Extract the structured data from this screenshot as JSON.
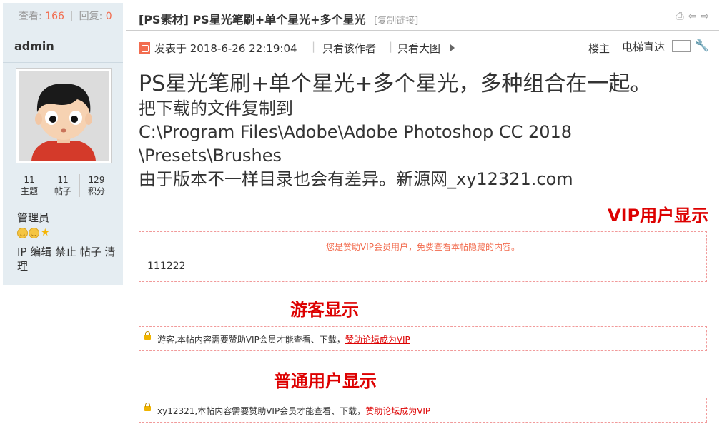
{
  "sidebar": {
    "views_label": "查看:",
    "views_count": "166",
    "replies_label": "回复:",
    "replies_count": "0",
    "username": "admin",
    "stats": [
      {
        "value": "11",
        "label": "主题"
      },
      {
        "value": "11",
        "label": "帖子"
      },
      {
        "value": "129",
        "label": "积分"
      }
    ],
    "role": "管理员",
    "admin_links": "IP 编辑 禁止 帖子 清理"
  },
  "thread": {
    "title": "[PS素材] PS星光笔刷+单个星光+多个星光",
    "copy_link": "[复制链接]"
  },
  "post_meta": {
    "posted_at": "发表于 2018-6-26 22:19:04",
    "only_author": "只看该作者",
    "only_images": "只看大图",
    "floor": "楼主",
    "elevator": "电梯直达"
  },
  "post": {
    "heading": "PS星光笔刷+单个星光+多个星光，多种组合在一起。",
    "lines": [
      "把下载的文件复制到",
      "C:\\Program Files\\Adobe\\Adobe Photoshop CC 2018",
      "\\Presets\\Brushes",
      "由于版本不一样目录也会有差异。新源网_xy12321.com"
    ]
  },
  "annotations": {
    "vip": "VIP用户显示",
    "guest": "游客显示",
    "normal": "普通用户显示"
  },
  "vip_box": {
    "notice": "您是赞助VIP会员用户，免费查看本帖隐藏的内容。",
    "content": "111222"
  },
  "guest_box": {
    "text": "游客,本帖内容需要赞助VIP会员才能查看、下载，",
    "link": "赞助论坛成为VIP"
  },
  "user_box": {
    "text": "xy12321,本帖内容需要赞助VIP会员才能查看、下载，",
    "link": "赞助论坛成为VIP"
  }
}
